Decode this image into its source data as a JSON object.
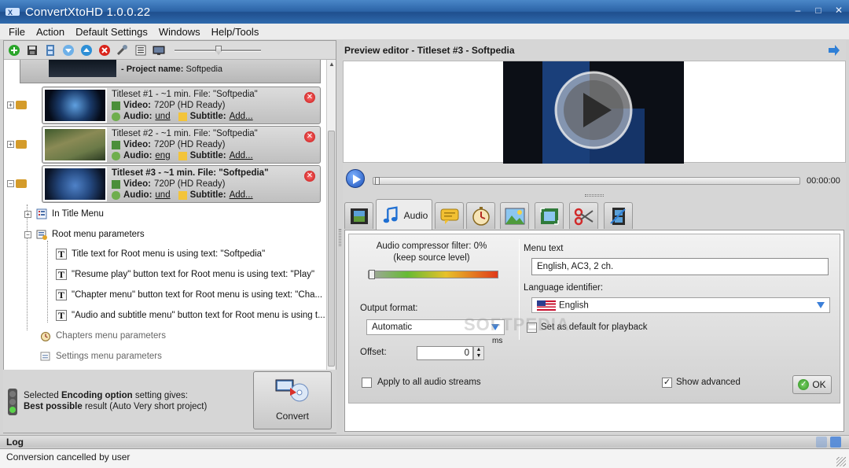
{
  "window": {
    "title": "ConvertXtoHD 1.0.0.22"
  },
  "menu": [
    "File",
    "Action",
    "Default Settings",
    "Windows",
    "Help/Tools"
  ],
  "project": {
    "label": "- Project name:",
    "name": "Softpedia"
  },
  "titlesets": [
    {
      "header": "Titleset #1 - ~1 min. File: \"Softpedia\"",
      "video_label": "Video:",
      "video": "720P (HD Ready)",
      "audio_label": "Audio:",
      "audio": "und",
      "subtitle_label": "Subtitle:",
      "subtitle": "Add...",
      "bold": false
    },
    {
      "header": "Titleset #2 - ~1 min. File: \"Softpedia\"",
      "video_label": "Video:",
      "video": "720P (HD Ready)",
      "audio_label": "Audio:",
      "audio": "eng",
      "subtitle_label": "Subtitle:",
      "subtitle": "Add...",
      "bold": false
    },
    {
      "header": "Titleset #3 - ~1 min. File: \"Softpedia\"",
      "video_label": "Video:",
      "video": "720P (HD Ready)",
      "audio_label": "Audio:",
      "audio": "und",
      "subtitle_label": "Subtitle:",
      "subtitle": "Add...",
      "bold": true
    }
  ],
  "tree": {
    "in_title_menu": "In Title Menu",
    "root_menu": "Root menu parameters",
    "root_items": [
      "Title text for Root menu is using text: \"Softpedia\"",
      "\"Resume play\" button text for Root menu is using text: \"Play\"",
      "\"Chapter menu\" button text for Root menu is using text: \"Cha...",
      "\"Audio and subtitle menu\" button text for Root menu is using t..."
    ],
    "chapters": "Chapters menu parameters",
    "settings": "Settings menu parameters"
  },
  "status": {
    "line1_prefix": "Selected ",
    "line1_bold": "Encoding option",
    "line1_suffix": " setting gives:",
    "line2_bold": "Best possible",
    "line2_suffix": " result (Auto Very short project)"
  },
  "convert_label": "Convert",
  "preview": {
    "title": "Preview editor - Titleset #3 - Softpedia",
    "time": "00:00:00"
  },
  "audio_tab": {
    "tab_label": "Audio",
    "compressor_line1": "Audio compressor filter: 0%",
    "compressor_line2": "(keep source level)",
    "output_format_label": "Output format:",
    "output_format": "Automatic",
    "ms_label": "ms",
    "offset_label": "Offset:",
    "offset_value": "0",
    "menu_text_label": "Menu text",
    "menu_text": "English, AC3, 2 ch.",
    "language_label": "Language identifier:",
    "language": "English",
    "default_playback": "Set as default for playback",
    "apply_all": "Apply to all audio streams",
    "show_advanced": "Show advanced",
    "ok": "OK"
  },
  "watermark": "SOFTPEDIA",
  "log": {
    "title": "Log",
    "message": "Conversion cancelled by user"
  }
}
